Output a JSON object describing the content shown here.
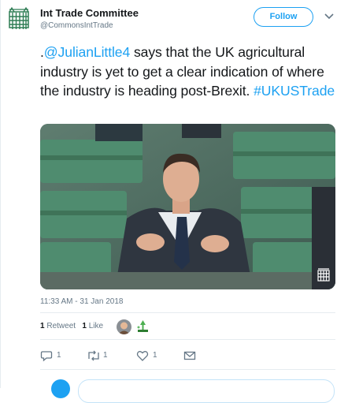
{
  "account": {
    "name": "Int Trade Committee",
    "handle": "@CommonsIntTrade",
    "avatar_icon": "portcullis-icon"
  },
  "follow_button": {
    "label": "Follow",
    "color": "#1da1f2"
  },
  "menu_icon": "chevron-down-icon",
  "tweet": {
    "prefix": ".",
    "mention": "@JulianLittle4",
    "body": " says that the UK agricultural industry is yet to get a clear indication of where the industry is heading post-Brexit. ",
    "hashtag": "#UKUSTrade"
  },
  "media": {
    "watermark_icon": "portcullis-icon"
  },
  "timestamp": "11:33 AM - 31 Jan 2018",
  "stats": {
    "retweets_count": "1",
    "retweets_label": "Retweet",
    "likes_count": "1",
    "likes_label": "Like"
  },
  "actions": {
    "reply_count": "1",
    "retweet_count": "1",
    "like_count": "1"
  },
  "colors": {
    "link": "#1da1f2",
    "secondary_text": "#657786",
    "border": "#e6ecf0"
  }
}
